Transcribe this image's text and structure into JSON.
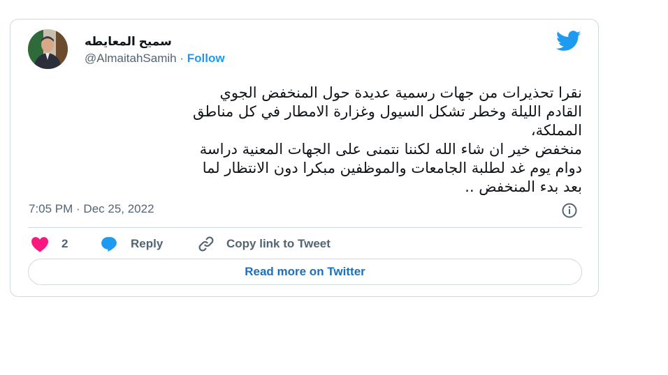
{
  "author": {
    "display_name": "سميح المعايطه",
    "handle": "@AlmaitahSamih",
    "separator": "·",
    "follow_label": "Follow"
  },
  "tweet": {
    "lines": [
      "نقرا تحذيرات من جهات رسمية عديدة حول المنخفض الجوي",
      "القادم الليلة وخطر تشكل السيول وغزارة الامطار في كل مناطق",
      "المملكة،",
      "منخفض خير ان شاء الله لكننا نتمنى على الجهات المعنية دراسة",
      "دوام يوم غد لطلبة الجامعات والموظفين مبكرا دون الانتظار لما",
      "بعد بدء المنخفض .."
    ],
    "timestamp": "7:05 PM · Dec 25, 2022"
  },
  "actions": {
    "like_count": "2",
    "reply_label": "Reply",
    "copy_label": "Copy link to Tweet"
  },
  "read_more_label": "Read more on Twitter",
  "colors": {
    "twitter_blue": "#1d9bf0",
    "like_pink": "#f91880",
    "border": "#cfd9de",
    "muted_text": "#536471"
  },
  "icons": [
    "twitter-bird-icon",
    "info-icon",
    "heart-icon",
    "reply-bubble-icon",
    "link-icon"
  ]
}
